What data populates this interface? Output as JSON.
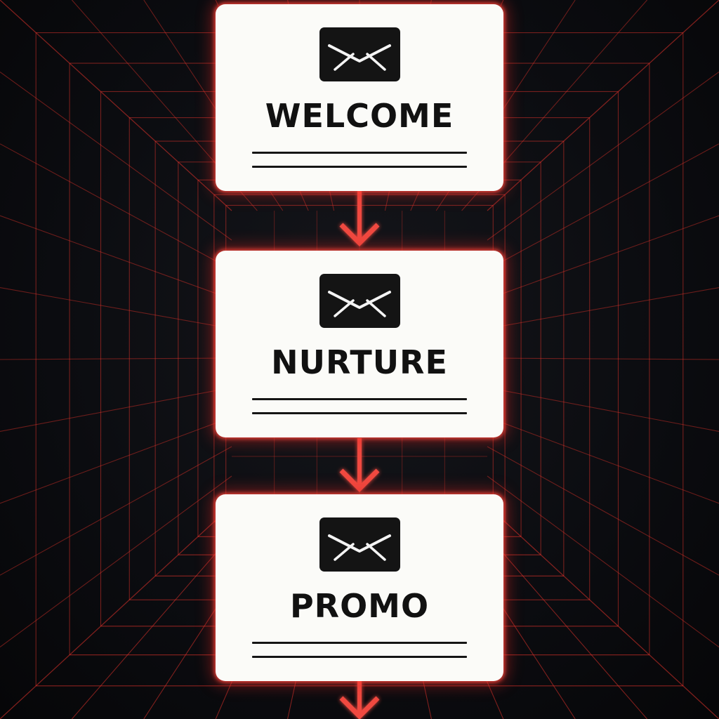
{
  "steps": [
    {
      "label": "WELCOME",
      "icon": "mail-icon"
    },
    {
      "label": "NURTURE",
      "icon": "mail-icon"
    },
    {
      "label": "PROMO",
      "icon": "mail-icon"
    }
  ],
  "colors": {
    "background": "#0a0b0e",
    "grid": "#e2332b",
    "arrow": "#f04a3f",
    "card": "#fbfbf8",
    "text": "#111111"
  }
}
